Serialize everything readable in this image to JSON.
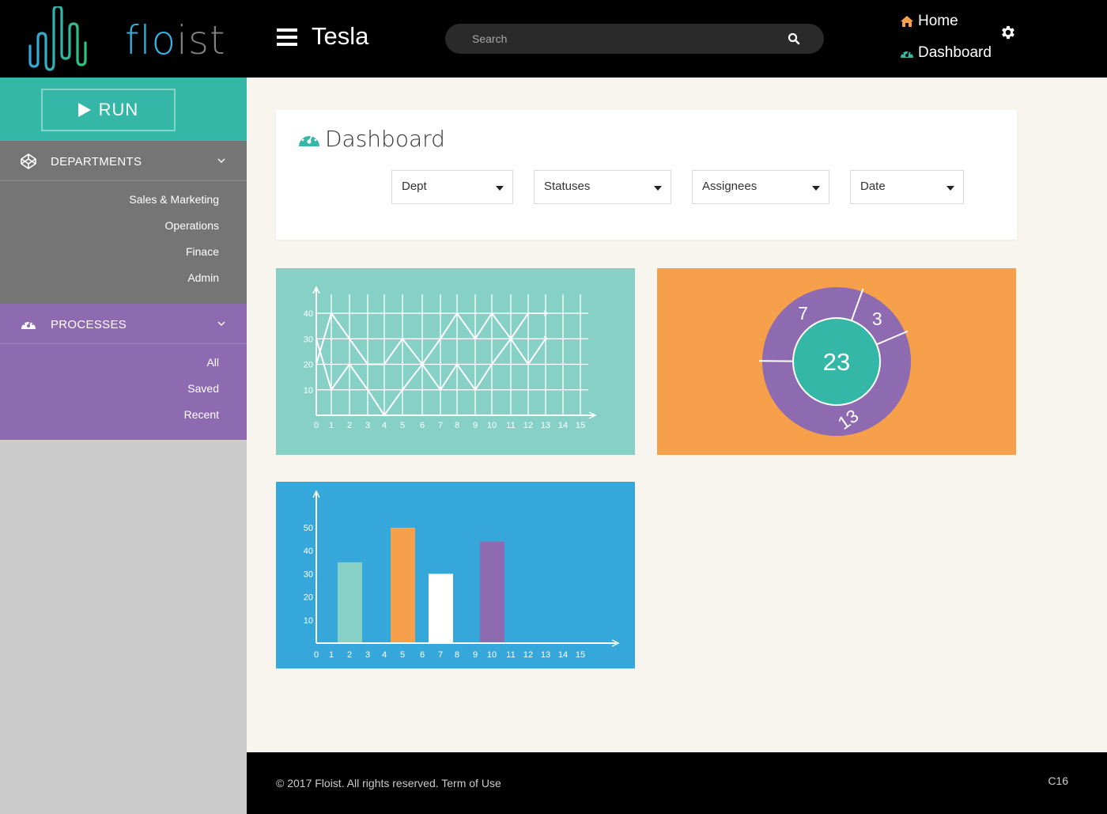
{
  "header": {
    "logo_part1": "flo",
    "logo_part2": "ist",
    "app_title": "Tesla",
    "search_placeholder": "Search",
    "nav": [
      {
        "label": "Home",
        "icon": "home-icon",
        "color": "#f7a04b"
      },
      {
        "label": "Dashboard",
        "icon": "dashboard-icon",
        "color": "#34b7a7"
      }
    ]
  },
  "sidebar": {
    "run_label": "RUN",
    "departments": {
      "label": "DEPARTMENTS",
      "items": [
        "Sales & Marketing",
        "Operations",
        "Finace",
        "Admin"
      ]
    },
    "processes": {
      "label": "PROCESSES",
      "items": [
        "All",
        "Saved",
        "Recent"
      ]
    }
  },
  "dashboard": {
    "title": "Dashboard",
    "filters": [
      "Dept",
      "Statuses",
      "Assignees",
      "Date"
    ]
  },
  "colors": {
    "teal": "#34b7a7",
    "light_teal": "#86d0c6",
    "orange": "#f7a04b",
    "purple": "#8e6ab1",
    "blue": "#35a7da",
    "gray": "#757575"
  },
  "chart_data": [
    {
      "type": "line",
      "x_ticks": [
        "0",
        "1",
        "2",
        "3",
        "4",
        "5",
        "6",
        "7",
        "8",
        "9",
        "10",
        "11",
        "12",
        "13",
        "14",
        "15"
      ],
      "y_ticks": [
        "10",
        "20",
        "30",
        "40"
      ],
      "series": [
        {
          "x": [
            0,
            1,
            2,
            3,
            4,
            5,
            6,
            7,
            8,
            9,
            10,
            11,
            12,
            13
          ],
          "y": [
            20,
            40,
            30,
            20,
            20,
            30,
            20,
            30,
            40,
            30,
            40,
            30,
            40,
            40
          ]
        },
        {
          "x": [
            0,
            1,
            2,
            3,
            4,
            5,
            6,
            7,
            8,
            9,
            10,
            11,
            12,
            13
          ],
          "y": [
            30,
            10,
            20,
            10,
            0,
            10,
            20,
            10,
            20,
            10,
            20,
            30,
            20,
            30
          ]
        }
      ],
      "xlim": [
        0,
        15
      ],
      "ylim": [
        0,
        45
      ],
      "grid": true
    },
    {
      "type": "pie",
      "center_label": "23",
      "slices": [
        {
          "label": "3",
          "value": 3
        },
        {
          "label": "13",
          "value": 13
        },
        {
          "label": "7",
          "value": 7
        }
      ]
    },
    {
      "type": "bar",
      "x_ticks": [
        "0",
        "1",
        "2",
        "3",
        "4",
        "5",
        "6",
        "7",
        "8",
        "9",
        "10",
        "11",
        "12",
        "13",
        "14",
        "15"
      ],
      "y_ticks": [
        "10",
        "20",
        "30",
        "40",
        "50"
      ],
      "bars": [
        {
          "x": 2,
          "value": 35,
          "color": "#86d0c6"
        },
        {
          "x": 5,
          "value": 50,
          "color": "#f7a04b"
        },
        {
          "x": 7,
          "value": 30,
          "color": "#ffffff"
        },
        {
          "x": 10,
          "value": 44,
          "color": "#8e6ab1"
        }
      ],
      "xlim": [
        0,
        15
      ],
      "ylim": [
        0,
        55
      ]
    }
  ],
  "footer": {
    "copyright": "© 2017 Floist.  All rights reserved.",
    "term_link": "Term of Use",
    "code": "C16"
  }
}
